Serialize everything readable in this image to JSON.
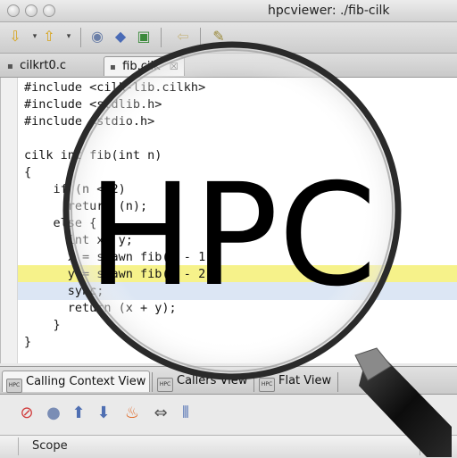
{
  "window": {
    "title": "hpcviewer: ./fib-cilk"
  },
  "toolbar": {
    "buttons": [
      {
        "icon": "arrow-down-icon",
        "glyph": "⇩",
        "color": "#d7a41c"
      },
      {
        "icon": "arrow-up-icon",
        "glyph": "⇧",
        "color": "#d7a41c"
      },
      {
        "icon": "zoom-icon",
        "glyph": "◉",
        "color": "#6b7fa8"
      },
      {
        "icon": "cube-icon",
        "glyph": "◆",
        "color": "#4a6bb6"
      },
      {
        "icon": "page-icon",
        "glyph": "▣",
        "color": "#3a8a3a"
      },
      {
        "icon": "back-icon",
        "glyph": "⇦",
        "color": "#c8b98a"
      },
      {
        "icon": "pin-icon",
        "glyph": "✎",
        "color": "#9a8a3a"
      }
    ]
  },
  "editor_tabs": [
    {
      "label": "cilkrt0.c",
      "active": false
    },
    {
      "label": "fib.cilk",
      "active": true,
      "close": "☒"
    }
  ],
  "source": {
    "lines": [
      "#include <cilk-lib.cilkh>",
      "#include <stdlib.h>",
      "#include <stdio.h>",
      "",
      "cilk int fib(int n)",
      "{",
      "    if (n < 2)",
      "      return (n);",
      "    else {",
      "      int x, y;",
      "      x = spawn fib(n - 1);",
      "      y = spawn fib(n - 2);",
      "      sync;",
      "      return (x + y);",
      "    }",
      "}"
    ],
    "highlighted_line_index": 11,
    "selected_line_index": 12
  },
  "view_tabs": [
    {
      "label": "Calling Context View",
      "active": true,
      "icon": "hpc-icon"
    },
    {
      "label": "Callers View",
      "active": false,
      "icon": "hpc-icon"
    },
    {
      "label": "Flat View",
      "active": false,
      "icon": "hpc-icon"
    }
  ],
  "view_toolbar": [
    {
      "icon": "filter-off-icon",
      "glyph": "⊘",
      "color": "#d13b3b"
    },
    {
      "icon": "zoom-out-icon",
      "glyph": "●",
      "color": "#7a8db5"
    },
    {
      "icon": "up-arrow-icon",
      "glyph": "⬆",
      "color": "#4f6fb2"
    },
    {
      "icon": "down-arrow-icon",
      "glyph": "⬇",
      "color": "#4f6fb2"
    },
    {
      "icon": "hot-path-icon",
      "glyph": "♨",
      "color": "#e0641f"
    },
    {
      "icon": "columns-icon",
      "glyph": "⇔",
      "color": "#555555"
    },
    {
      "icon": "metric-icon",
      "glyph": "⦀",
      "color": "#4f6fb2"
    }
  ],
  "scope": {
    "header": "Scope"
  },
  "overlay": {
    "logo_text": "HPC"
  },
  "colors": {
    "highlight": "#f6f28a",
    "selection": "#dce6f4",
    "lens_rim": "#2a2a2a",
    "handle": "#161616"
  }
}
